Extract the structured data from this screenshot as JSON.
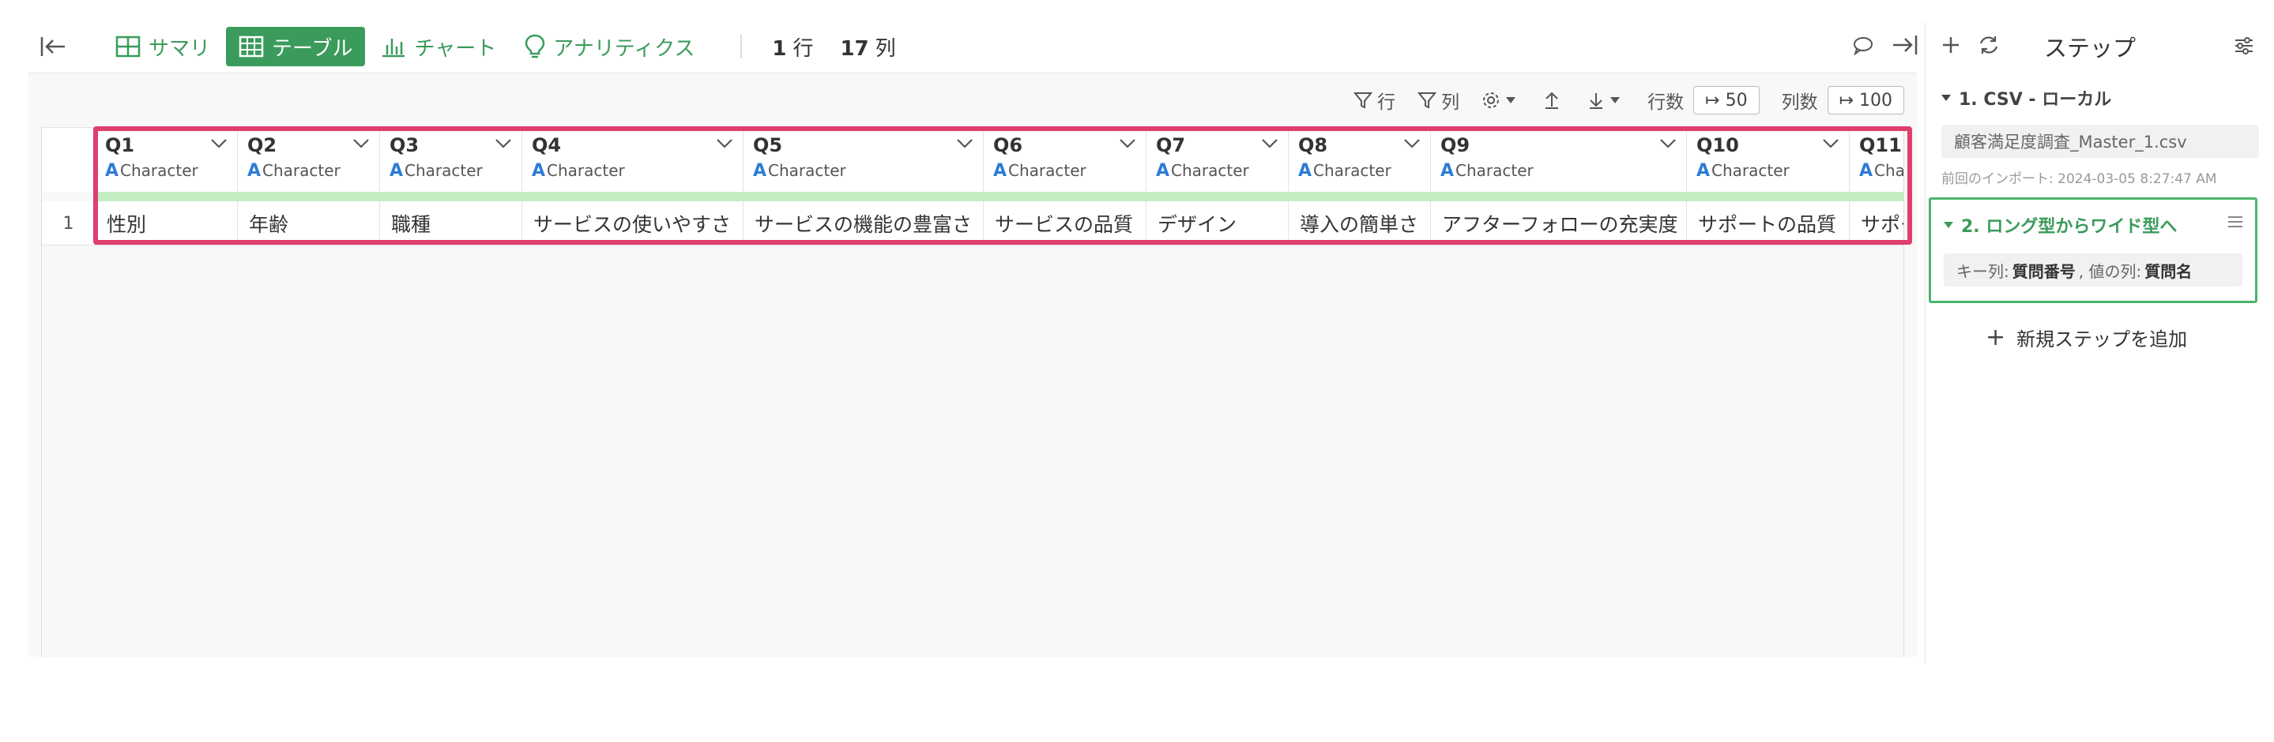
{
  "toolbar": {
    "tabs": [
      {
        "label": "サマリ"
      },
      {
        "label": "テーブル"
      },
      {
        "label": "チャート"
      },
      {
        "label": "アナリティクス"
      }
    ],
    "rows_count": "1",
    "rows_unit": "行",
    "cols_count": "17",
    "cols_unit": "列"
  },
  "subbar": {
    "row_filter": "行",
    "col_filter": "列",
    "rows_label": "行数",
    "rows_limit": "↦ 50",
    "cols_label": "列数",
    "cols_limit": "↦ 100"
  },
  "table": {
    "type_label": "Character",
    "columns": [
      {
        "name": "Q1",
        "value": "性別"
      },
      {
        "name": "Q2",
        "value": "年齢"
      },
      {
        "name": "Q3",
        "value": "職種"
      },
      {
        "name": "Q4",
        "value": "サービスの使いやすさ"
      },
      {
        "name": "Q5",
        "value": "サービスの機能の豊富さ"
      },
      {
        "name": "Q6",
        "value": "サービスの品質"
      },
      {
        "name": "Q7",
        "value": "デザイン"
      },
      {
        "name": "Q8",
        "value": "導入の簡単さ"
      },
      {
        "name": "Q9",
        "value": "アフターフォローの充実度"
      },
      {
        "name": "Q10",
        "value": "サポートの品質"
      },
      {
        "name": "Q11",
        "value": "サポート"
      }
    ],
    "row_number": "1"
  },
  "panel": {
    "title": "ステップ",
    "step1": {
      "title": "1. CSV - ローカル",
      "file": "顧客満足度調査_Master_1.csv",
      "import_note": "前回のインポート: 2024-03-05 8:27:47 AM"
    },
    "step2": {
      "title": "2. ロング型からワイド型へ",
      "key_label": "キー列:",
      "key_value": "質問番号",
      "val_label": ", 値の列:",
      "val_value": "質問名"
    },
    "add_step": "新規ステップを追加"
  },
  "colors": {
    "accent": "#3a9b5c",
    "highlight": "#de3f6c",
    "type_icon": "#2e7bd6",
    "new_col_bar": "#c5eec2"
  }
}
